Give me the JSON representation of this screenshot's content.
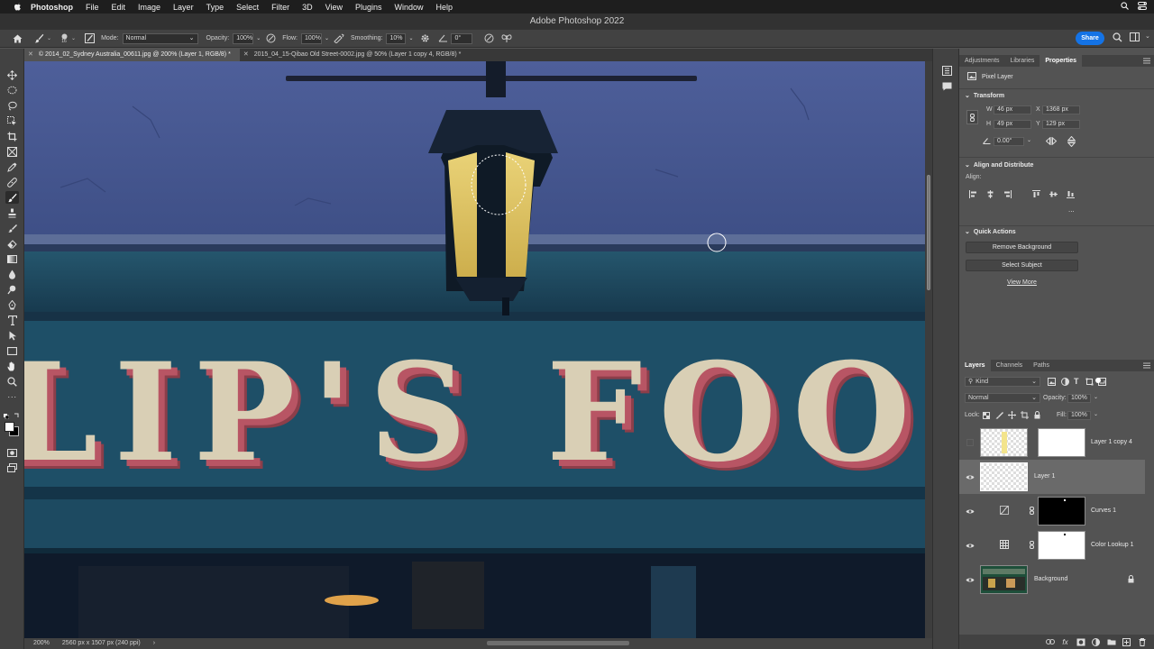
{
  "menubar": {
    "app_name": "Photoshop",
    "items": [
      "File",
      "Edit",
      "Image",
      "Layer",
      "Type",
      "Select",
      "Filter",
      "3D",
      "View",
      "Plugins",
      "Window",
      "Help"
    ]
  },
  "window": {
    "title": "Adobe Photoshop 2022"
  },
  "options": {
    "mode_label": "Mode:",
    "mode_value": "Normal",
    "opacity_label": "Opacity:",
    "opacity_value": "100%",
    "flow_label": "Flow:",
    "flow_value": "100%",
    "smoothing_label": "Smoothing:",
    "smoothing_value": "10%",
    "angle_value": "0°",
    "brush_size": "16",
    "share_label": "Share"
  },
  "tabs": [
    {
      "label": "© 2014_02_Sydney Australia_00611.jpg @ 200% (Layer 1, RGB/8) *"
    },
    {
      "label": "2015_04_15-Qibao Old Street-0002.jpg @ 50% (Layer 1 copy 4, RGB/8) *"
    }
  ],
  "canvas": {
    "sign_text": "LIP'S FOO"
  },
  "status": {
    "zoom": "200%",
    "doc_info": "2560 px x 1507 px (240 ppi)",
    "arrow": "›"
  },
  "properties": {
    "tabs": [
      "Adjustments",
      "Libraries",
      "Properties"
    ],
    "kind": "Pixel Layer",
    "transform_title": "Transform",
    "w_label": "W",
    "w_value": "46 px",
    "x_label": "X",
    "x_value": "1368 px",
    "h_label": "H",
    "h_value": "49 px",
    "y_label": "Y",
    "y_value": "129 px",
    "angle_value": "0.00°",
    "align_title": "Align and Distribute",
    "align_label": "Align:",
    "more": "...",
    "quick_title": "Quick Actions",
    "remove_bg": "Remove Background",
    "select_subject": "Select Subject",
    "view_more": "View More"
  },
  "layers_panel": {
    "tabs": [
      "Layers",
      "Channels",
      "Paths"
    ],
    "kind_label": "Kind",
    "blend_mode": "Normal",
    "opacity_label": "Opacity:",
    "opacity_value": "100%",
    "lock_label": "Lock:",
    "fill_label": "Fill:",
    "fill_value": "100%",
    "layers": [
      {
        "name": "Layer 1 copy 4",
        "visible": false,
        "selected": false
      },
      {
        "name": "Layer 1",
        "visible": true,
        "selected": true
      },
      {
        "name": "Curves 1",
        "visible": true,
        "selected": false
      },
      {
        "name": "Color Lookup 1",
        "visible": true,
        "selected": false
      },
      {
        "name": "Background",
        "visible": true,
        "selected": false
      }
    ]
  },
  "colors": {
    "accent": "#1473e6",
    "lamp_glass": "#e9cf6a",
    "sign_letter": "#d9cfb5",
    "sign_shadow": "#b85564",
    "wall": "#4a5a94",
    "fascia": "#1e4d63"
  }
}
